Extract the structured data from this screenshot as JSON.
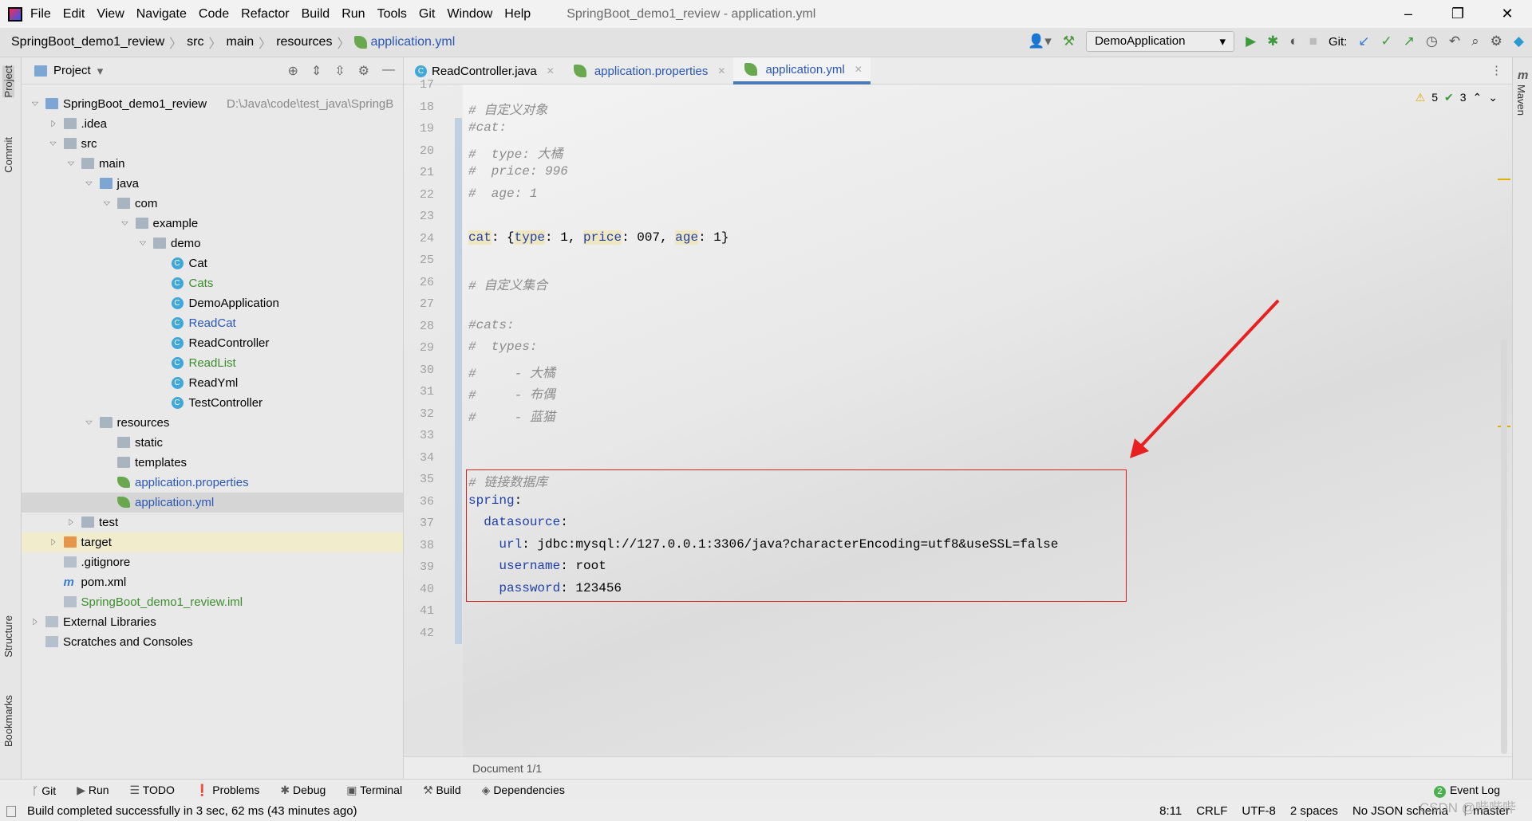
{
  "window": {
    "title": "SpringBoot_demo1_review - application.yml",
    "minimize": "–",
    "restore": "❐",
    "close": "✕"
  },
  "menu": [
    "File",
    "Edit",
    "View",
    "Navigate",
    "Code",
    "Refactor",
    "Build",
    "Run",
    "Tools",
    "Git",
    "Window",
    "Help"
  ],
  "breadcrumb": [
    "SpringBoot_demo1_review",
    "src",
    "main",
    "resources",
    "application.yml"
  ],
  "toolbar": {
    "run_config": "DemoApplication",
    "git_label": "Git:"
  },
  "left_strip": [
    "Project",
    "Commit",
    "Structure",
    "Bookmarks"
  ],
  "right_strip": [
    "Maven"
  ],
  "project_panel": {
    "title": "Project"
  },
  "tree": [
    {
      "label": "SpringBoot_demo1_review",
      "path": "D:\\Java\\code\\test_java\\SpringB",
      "level": 0,
      "arrow": "open",
      "icon": "module-folder-icon"
    },
    {
      "label": ".idea",
      "level": 1,
      "arrow": "closed",
      "icon": "folder-icon"
    },
    {
      "label": "src",
      "level": 1,
      "arrow": "open",
      "icon": "folder-icon"
    },
    {
      "label": "main",
      "level": 2,
      "arrow": "open",
      "icon": "folder-icon"
    },
    {
      "label": "java",
      "level": 3,
      "arrow": "open",
      "icon": "source-folder-icon"
    },
    {
      "label": "com",
      "level": 4,
      "arrow": "open",
      "icon": "package-icon"
    },
    {
      "label": "example",
      "level": 5,
      "arrow": "open",
      "icon": "package-icon"
    },
    {
      "label": "demo",
      "level": 6,
      "arrow": "open",
      "icon": "package-icon"
    },
    {
      "label": "Cat",
      "level": 7,
      "icon": "class-icon"
    },
    {
      "label": "Cats",
      "level": 7,
      "icon": "class-icon",
      "color": "green"
    },
    {
      "label": "DemoApplication",
      "level": 7,
      "icon": "spring-class-icon"
    },
    {
      "label": "ReadCat",
      "level": 7,
      "icon": "class-icon",
      "color": "blue"
    },
    {
      "label": "ReadController",
      "level": 7,
      "icon": "class-icon"
    },
    {
      "label": "ReadList",
      "level": 7,
      "icon": "class-icon",
      "color": "green"
    },
    {
      "label": "ReadYml",
      "level": 7,
      "icon": "class-icon"
    },
    {
      "label": "TestController",
      "level": 7,
      "icon": "class-icon"
    },
    {
      "label": "resources",
      "level": 3,
      "arrow": "open",
      "icon": "resources-folder-icon"
    },
    {
      "label": "static",
      "level": 4,
      "icon": "folder-icon"
    },
    {
      "label": "templates",
      "level": 4,
      "icon": "folder-icon"
    },
    {
      "label": "application.properties",
      "level": 4,
      "icon": "spring-config-icon",
      "color": "blue"
    },
    {
      "label": "application.yml",
      "level": 4,
      "icon": "spring-config-icon",
      "color": "blue",
      "selected": true
    },
    {
      "label": "test",
      "level": 2,
      "arrow": "closed",
      "icon": "folder-icon"
    },
    {
      "label": "target",
      "level": 1,
      "arrow": "closed",
      "icon": "excluded-folder-icon",
      "highlight": true
    },
    {
      "label": ".gitignore",
      "level": 1,
      "icon": "file-icon"
    },
    {
      "label": "pom.xml",
      "level": 1,
      "icon": "maven-icon"
    },
    {
      "label": "SpringBoot_demo1_review.iml",
      "level": 1,
      "icon": "iml-file-icon",
      "color": "green"
    },
    {
      "label": "External Libraries",
      "level": 0,
      "arrow": "closed",
      "icon": "library-icon"
    },
    {
      "label": "Scratches and Consoles",
      "level": 0,
      "icon": "scratches-icon"
    }
  ],
  "tabs": [
    {
      "label": "ReadController.java",
      "icon": "class-icon"
    },
    {
      "label": "application.properties",
      "icon": "spring-config-icon",
      "color": "blue"
    },
    {
      "label": "application.yml",
      "icon": "spring-config-icon",
      "color": "blue",
      "active": true
    }
  ],
  "editor": {
    "inspections": {
      "warnings": "5",
      "ok": "3"
    },
    "lines": [
      {
        "n": "17",
        "html": ""
      },
      {
        "n": "18",
        "parts": [
          [
            "cm",
            "# 自定义对象"
          ]
        ]
      },
      {
        "n": "19",
        "parts": [
          [
            "cm",
            "#cat:"
          ]
        ]
      },
      {
        "n": "20",
        "parts": [
          [
            "cm",
            "#  type: 大橘"
          ]
        ]
      },
      {
        "n": "21",
        "parts": [
          [
            "cm",
            "#  price: 996"
          ]
        ]
      },
      {
        "n": "22",
        "parts": [
          [
            "cm",
            "#  age: 1"
          ]
        ]
      },
      {
        "n": "23",
        "parts": []
      },
      {
        "n": "24",
        "parts": [
          [
            "key khl",
            "cat"
          ],
          [
            "",
            ": {"
          ],
          [
            "key khl",
            "type"
          ],
          [
            "",
            ": 1, "
          ],
          [
            "key khl",
            "price"
          ],
          [
            "",
            ": 007, "
          ],
          [
            "key khl",
            "age"
          ],
          [
            "",
            ": 1}"
          ]
        ]
      },
      {
        "n": "25",
        "parts": []
      },
      {
        "n": "26",
        "parts": [
          [
            "cm",
            "# 自定义集合"
          ]
        ]
      },
      {
        "n": "27",
        "parts": []
      },
      {
        "n": "28",
        "parts": [
          [
            "cm",
            "#cats:"
          ]
        ]
      },
      {
        "n": "29",
        "parts": [
          [
            "cm",
            "#  types:"
          ]
        ]
      },
      {
        "n": "30",
        "parts": [
          [
            "cm",
            "#     - 大橘"
          ]
        ]
      },
      {
        "n": "31",
        "parts": [
          [
            "cm",
            "#     - 布偶"
          ]
        ]
      },
      {
        "n": "32",
        "parts": [
          [
            "cm",
            "#     - 蓝猫"
          ]
        ]
      },
      {
        "n": "33",
        "parts": []
      },
      {
        "n": "34",
        "parts": []
      },
      {
        "n": "35",
        "parts": [
          [
            "cm",
            "# 链接数据库"
          ]
        ]
      },
      {
        "n": "36",
        "parts": [
          [
            "key",
            "spring"
          ],
          [
            "",
            ":"
          ]
        ]
      },
      {
        "n": "37",
        "parts": [
          [
            "",
            "  "
          ],
          [
            "key",
            "datasource"
          ],
          [
            "",
            ":"
          ]
        ]
      },
      {
        "n": "38",
        "parts": [
          [
            "",
            "    "
          ],
          [
            "key",
            "url"
          ],
          [
            "",
            ": jdbc:mysql://127.0.0.1:3306/java?characterEncoding=utf8&useSSL=false"
          ]
        ]
      },
      {
        "n": "39",
        "parts": [
          [
            "",
            "    "
          ],
          [
            "key",
            "username"
          ],
          [
            "",
            ": root"
          ]
        ]
      },
      {
        "n": "40",
        "parts": [
          [
            "",
            "    "
          ],
          [
            "key",
            "password"
          ],
          [
            "",
            ": 123456"
          ]
        ]
      },
      {
        "n": "41",
        "parts": []
      },
      {
        "n": "42",
        "parts": []
      }
    ],
    "doc_status": "Document 1/1"
  },
  "annotation": {
    "color": "#e02020"
  },
  "tool_windows": [
    "Git",
    "Run",
    "TODO",
    "Problems",
    "Debug",
    "Terminal",
    "Build",
    "Dependencies"
  ],
  "event_log": {
    "count": "2",
    "label": "Event Log"
  },
  "status": {
    "message": "Build completed successfully in 3 sec, 62 ms (43 minutes ago)",
    "position": "8:11",
    "line_sep": "CRLF",
    "encoding": "UTF-8",
    "indent": "2 spaces",
    "schema": "No JSON schema",
    "branch": "master"
  },
  "watermark": "CSDN @哔哔哔"
}
